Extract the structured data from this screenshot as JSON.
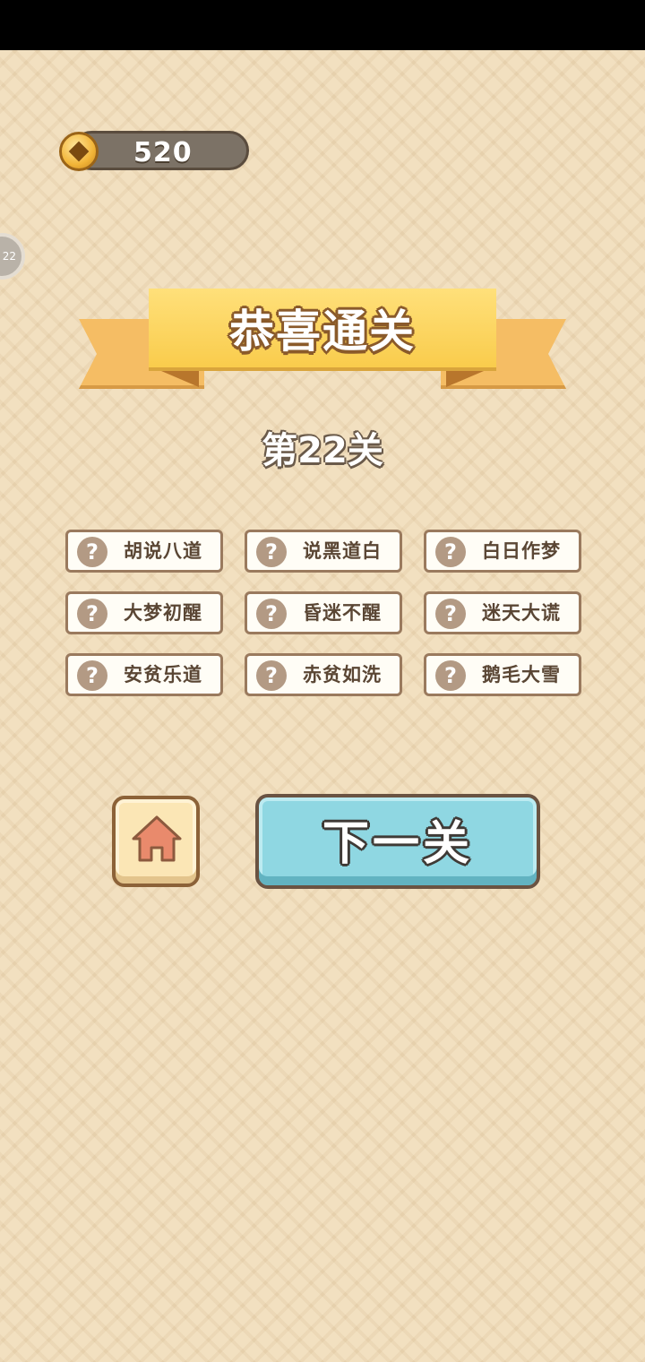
{
  "coins": {
    "value": "520",
    "icon": "coin-icon"
  },
  "side_badge": {
    "label": "22"
  },
  "banner": {
    "title": "恭喜通关"
  },
  "level": {
    "label": "第22关"
  },
  "idioms": [
    {
      "text": "胡说八道",
      "icon": "question-icon",
      "symbol": "?"
    },
    {
      "text": "说黑道白",
      "icon": "question-icon",
      "symbol": "?"
    },
    {
      "text": "白日作梦",
      "icon": "question-icon",
      "symbol": "?"
    },
    {
      "text": "大梦初醒",
      "icon": "question-icon",
      "symbol": "?"
    },
    {
      "text": "昏迷不醒",
      "icon": "question-icon",
      "symbol": "?"
    },
    {
      "text": "迷天大谎",
      "icon": "question-icon",
      "symbol": "?"
    },
    {
      "text": "安贫乐道",
      "icon": "question-icon",
      "symbol": "?"
    },
    {
      "text": "赤贫如洗",
      "icon": "question-icon",
      "symbol": "?"
    },
    {
      "text": "鹅毛大雪",
      "icon": "question-icon",
      "symbol": "?"
    }
  ],
  "buttons": {
    "home_icon": "home-icon",
    "next_label": "下一关"
  },
  "colors": {
    "background": "#f2e0c0",
    "ribbon": "#f9cc4c",
    "next_button": "#8fd7e2",
    "home_icon": "#e98a6c",
    "card_border": "#9a7a5e"
  }
}
